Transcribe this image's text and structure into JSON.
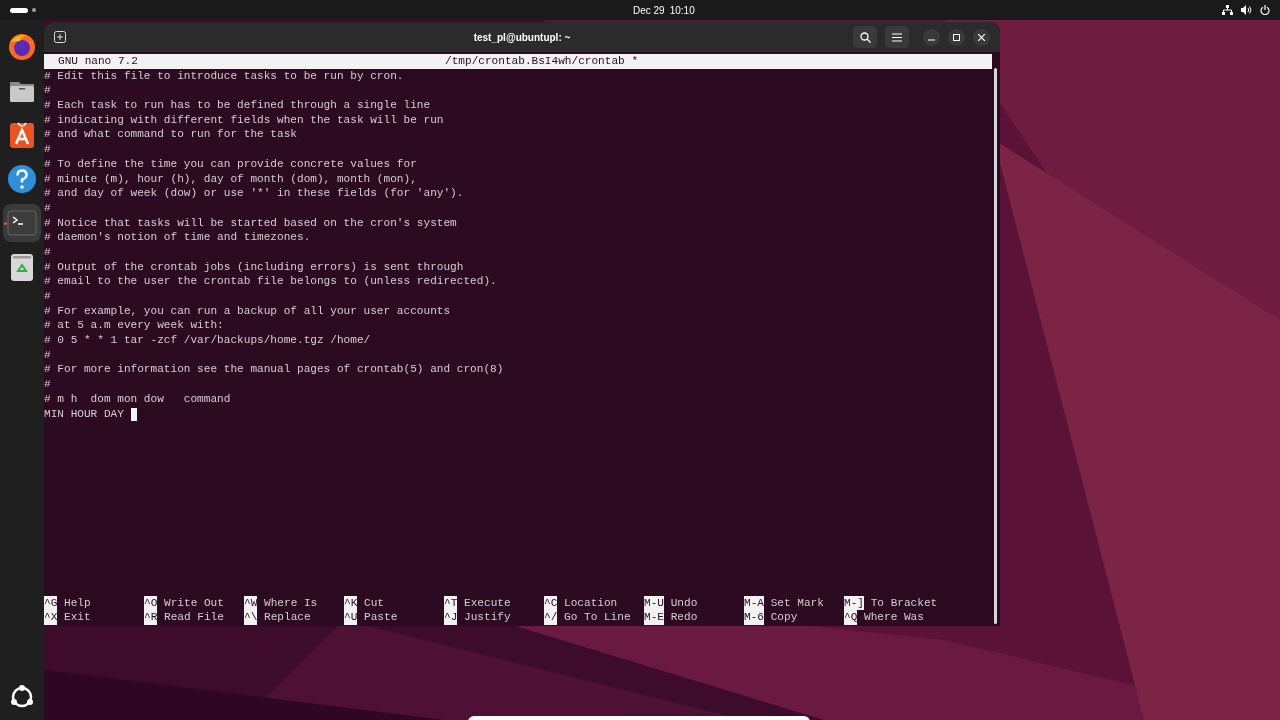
{
  "top_bar": {
    "date": "Dec 29",
    "time": "10:10"
  },
  "dock": {
    "items": [
      {
        "kind": "browser",
        "selected": false
      },
      {
        "kind": "files",
        "selected": false
      },
      {
        "kind": "store",
        "selected": false
      },
      {
        "kind": "help",
        "selected": false
      },
      {
        "kind": "terminal",
        "selected": true
      },
      {
        "kind": "trash",
        "selected": false
      }
    ]
  },
  "window": {
    "title": "test_pl@ubuntupl: ~"
  },
  "nano": {
    "version": "GNU nano 7.2",
    "filename": "/tmp/crontab.BsI4wh/crontab *",
    "lines": [
      "# Edit this file to introduce tasks to be run by cron.",
      "#",
      "# Each task to run has to be defined through a single line",
      "# indicating with different fields when the task will be run",
      "# and what command to run for the task",
      "#",
      "# To define the time you can provide concrete values for",
      "# minute (m), hour (h), day of month (dom), month (mon),",
      "# and day of week (dow) or use '*' in these fields (for 'any').",
      "#",
      "# Notice that tasks will be started based on the cron's system",
      "# daemon's notion of time and timezones.",
      "#",
      "# Output of the crontab jobs (including errors) is sent through",
      "# email to the user the crontab file belongs to (unless redirected).",
      "#",
      "# For example, you can run a backup of all your user accounts",
      "# at 5 a.m every week with:",
      "# 0 5 * * 1 tar -zcf /var/backups/home.tgz /home/",
      "#",
      "# For more information see the manual pages of crontab(5) and cron(8)",
      "#",
      "# m h  dom mon dow   command",
      "MIN HOUR DAY "
    ],
    "shortcuts": [
      {
        "key": "^G",
        "label": "Help"
      },
      {
        "key": "^X",
        "label": "Exit"
      },
      {
        "key": "^O",
        "label": "Write Out"
      },
      {
        "key": "^R",
        "label": "Read File"
      },
      {
        "key": "^W",
        "label": "Where Is"
      },
      {
        "key": "^\\",
        "label": "Replace"
      },
      {
        "key": "^K",
        "label": "Cut"
      },
      {
        "key": "^U",
        "label": "Paste"
      },
      {
        "key": "^T",
        "label": "Execute"
      },
      {
        "key": "^J",
        "label": "Justify"
      },
      {
        "key": "^C",
        "label": "Location"
      },
      {
        "key": "^/",
        "label": "Go To Line"
      },
      {
        "key": "M-U",
        "label": "Undo"
      },
      {
        "key": "M-E",
        "label": "Redo"
      },
      {
        "key": "M-A",
        "label": "Set Mark"
      },
      {
        "key": "M-6",
        "label": "Copy"
      },
      {
        "key": "M-]",
        "label": "To Bracket"
      },
      {
        "key": "^Q",
        "label": "Where Was"
      }
    ]
  }
}
